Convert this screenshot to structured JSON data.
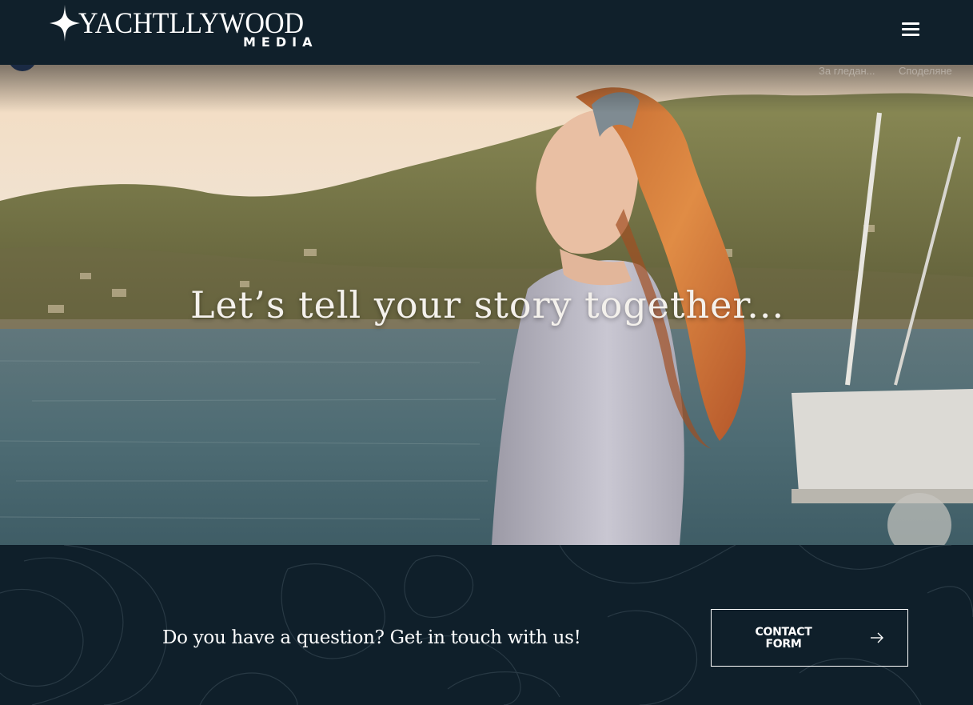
{
  "header": {
    "brand_main": "YACHTLLYWOOD",
    "brand_sub": "MEDIA",
    "menu_icon": "hamburger-icon"
  },
  "hero": {
    "caption": "Let’s tell your story together...",
    "video_actions": [
      "За гледан...",
      "Споделяне"
    ]
  },
  "cta": {
    "question": "Do you have a question? Get in touch with us!",
    "button_line1": "CONTACT",
    "button_line2": "FORM",
    "button_icon": "arrow-right-icon"
  },
  "colors": {
    "header_bg": "#10202b",
    "footer_bg": "#0f1f2a",
    "text": "#ffffff"
  }
}
